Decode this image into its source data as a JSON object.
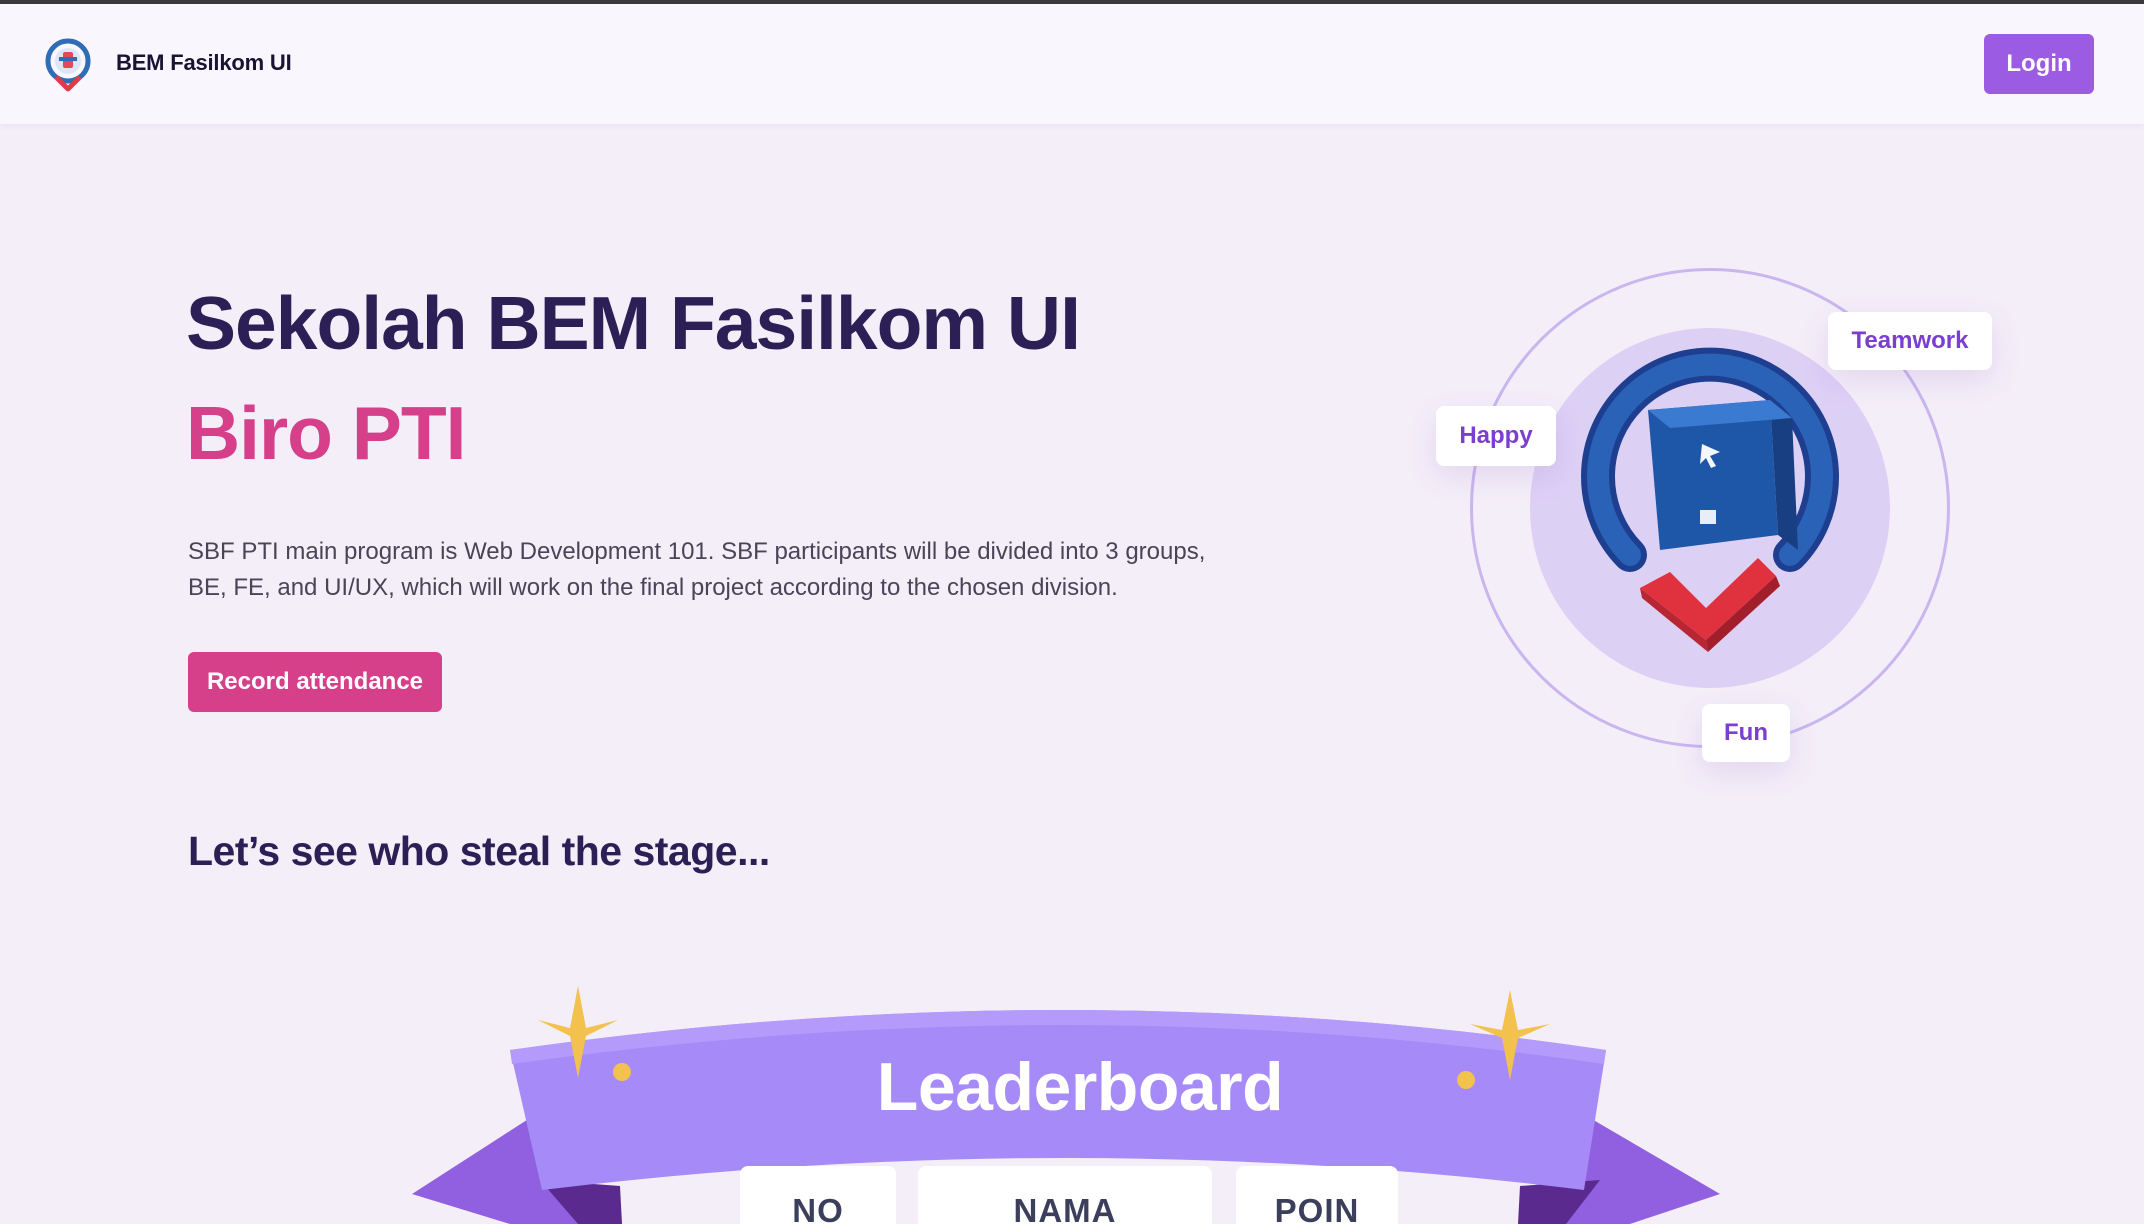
{
  "navbar": {
    "brand": "BEM Fasilkom UI",
    "login_label": "Login",
    "logo_icon": "bem-logo-icon"
  },
  "hero": {
    "title": "Sekolah BEM Fasilkom UI",
    "subtitle": "Biro PTI",
    "description": "SBF PTI main program is Web Development 101. SBF participants will be divided into 3 groups, BE, FE, and UI/UX, which will work on the final project according to the chosen division.",
    "cta_label": "Record attendance"
  },
  "illustration": {
    "icon": "location-check-icon",
    "tags": [
      "Teamwork",
      "Happy",
      "Fun"
    ]
  },
  "section": {
    "heading": "Let’s see who steal the stage..."
  },
  "leaderboard": {
    "title": "Leaderboard",
    "columns": [
      "NO",
      "NAMA",
      "POIN"
    ]
  },
  "colors": {
    "primary_purple": "#9b5be3",
    "accent_pink": "#d63f8a",
    "heading_dark": "#2b1f56",
    "background": "#f4eef9",
    "ribbon": "#a78bfa"
  }
}
